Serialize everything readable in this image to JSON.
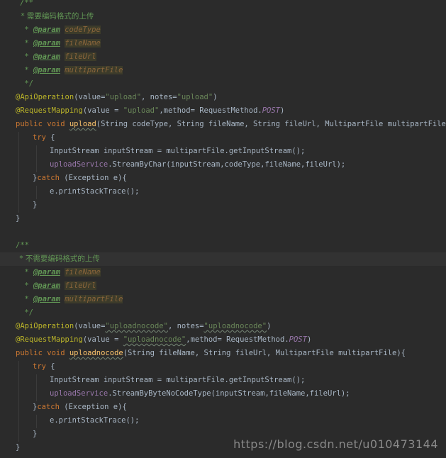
{
  "code": {
    "block1": {
      "doc_open": "/**",
      "doc_desc": " * 需要编码格式的上传",
      "tag": "@param",
      "params": [
        "codeType",
        "fileName",
        "fileUrl",
        "multipartFile"
      ],
      "doc_close": " */",
      "ann1": "@ApiOperation",
      "ann1_args_a": "(value=",
      "ann1_v1": "\"upload\"",
      "ann1_args_b": ", notes=",
      "ann1_v2": "\"upload\"",
      "ann1_args_c": ")",
      "ann2": "@RequestMapping",
      "ann2_args_a": "(value = ",
      "ann2_v1": "\"upload\"",
      "ann2_args_b": ",method= RequestMethod.",
      "ann2_const": "POST",
      "ann2_args_c": ")",
      "sig_kw": "public void ",
      "sig_name": "upload",
      "sig_params": "(String codeType, String fileName, String fileUrl, MultipartFile multipartFile){",
      "try_kw": "try",
      "try_brace": " {",
      "stmt1": "InputStream inputStream = multipartFile.getInputStream();",
      "stmt2_field": "uploadService",
      "stmt2_rest": ".StreamByChar(inputStream,codeType,fileName,fileUrl);",
      "catch_open": "}",
      "catch_kw": "catch",
      "catch_rest": " (Exception e){",
      "stmt3": "e.printStackTrace();",
      "close_inner": "}",
      "close_outer": "}"
    },
    "block2": {
      "doc_open": "/**",
      "doc_desc": " * 不需要编码格式的上传",
      "tag": "@param",
      "params": [
        "fileName",
        "fileUrl",
        "multipartFile"
      ],
      "doc_close": " */",
      "ann1": "@ApiOperation",
      "ann1_args_a": "(value=",
      "ann1_v1": "\"uploadnocode\"",
      "ann1_args_b": ", notes=",
      "ann1_v2": "\"uploadnocode\"",
      "ann1_args_c": ")",
      "ann2": "@RequestMapping",
      "ann2_args_a": "(value = ",
      "ann2_v1": "\"uploadnocode\"",
      "ann2_args_b": ",method= RequestMethod.",
      "ann2_const": "POST",
      "ann2_args_c": ")",
      "sig_kw": "public void ",
      "sig_name": "uploadnocode",
      "sig_params": "(String fileName, String fileUrl, MultipartFile multipartFile){",
      "try_kw": "try",
      "try_brace": " {",
      "stmt1": "InputStream inputStream = multipartFile.getInputStream();",
      "stmt2_field": "uploadService",
      "stmt2_rest": ".StreamByByteNoCodeType(inputStream,fileName,fileUrl);",
      "catch_open": "}",
      "catch_kw": "catch",
      "catch_rest": " (Exception e){",
      "stmt3": "e.printStackTrace();",
      "close_inner": "}",
      "close_outer": "}"
    }
  },
  "watermark": "https://blog.csdn.net/u010473144"
}
